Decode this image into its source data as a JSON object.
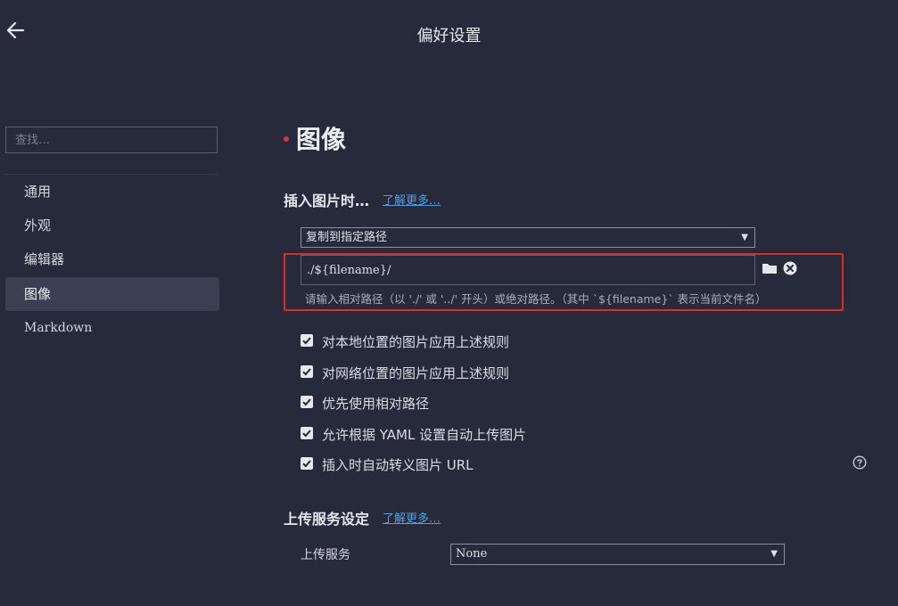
{
  "header": {
    "title": "偏好设置",
    "back_icon": "arrow-left-icon"
  },
  "sidebar": {
    "search_placeholder": "查找…",
    "items": [
      {
        "label": "通用",
        "active": false
      },
      {
        "label": "外观",
        "active": false
      },
      {
        "label": "编辑器",
        "active": false
      },
      {
        "label": "图像",
        "active": true
      },
      {
        "label": "Markdown",
        "active": false
      }
    ]
  },
  "main": {
    "heading": "图像",
    "insert_section": {
      "title": "插入图片时…",
      "learn_more": "了解更多…",
      "action_select": "复制到指定路径",
      "path_value": "./${filename}/",
      "hint": "请输入相对路径（以 './' 或 '../' 开头）或绝对路径。（其中 `${filename}` 表示当前文件名）"
    },
    "options": [
      {
        "label": "对本地位置的图片应用上述规则",
        "checked": true
      },
      {
        "label": "对网络位置的图片应用上述规则",
        "checked": true
      },
      {
        "label": "优先使用相对路径",
        "checked": true
      },
      {
        "label": "允许根据 YAML 设置自动上传图片",
        "checked": true
      },
      {
        "label": "插入时自动转义图片 URL",
        "checked": true
      }
    ],
    "upload_section": {
      "title": "上传服务设定",
      "learn_more": "了解更多…",
      "service_label": "上传服务",
      "service_value": "None"
    }
  },
  "colors": {
    "background": "#262a3b",
    "accent_link": "#4aa3e6",
    "highlight_box": "#e02a2a",
    "active_nav": "#3a3f52"
  }
}
